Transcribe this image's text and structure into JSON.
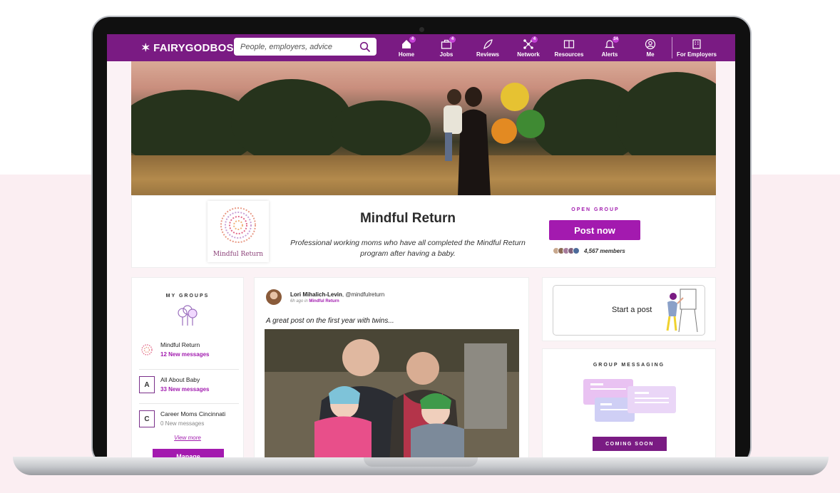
{
  "nav": {
    "logo": "FAIRYGODBOSS",
    "search_placeholder": "People, employers, advice",
    "items": [
      {
        "label": "Home",
        "icon": "home-icon",
        "badge": "4"
      },
      {
        "label": "Jobs",
        "icon": "briefcase-icon",
        "badge": "4"
      },
      {
        "label": "Reviews",
        "icon": "feather-icon",
        "badge": ""
      },
      {
        "label": "Network",
        "icon": "network-icon",
        "badge": "4"
      },
      {
        "label": "Resources",
        "icon": "book-icon",
        "badge": ""
      },
      {
        "label": "Alerts",
        "icon": "bell-icon",
        "badge": "34"
      },
      {
        "label": "Me",
        "icon": "user-circle-icon",
        "badge": ""
      }
    ],
    "employers_label": "For Employers"
  },
  "group": {
    "logo_text": "Mindful Return",
    "title": "Mindful Return",
    "description": "Professional working moms who have all completed the Mindful Return program after having a baby.",
    "status": "OPEN GROUP",
    "post_button": "Post now",
    "members": "4,567 members"
  },
  "my_groups": {
    "title": "MY GROUPS",
    "items": [
      {
        "thumb": "",
        "name": "Mindful Return",
        "messages": "12 New messages"
      },
      {
        "thumb": "A",
        "name": "All About Baby",
        "messages": "33 New messages"
      },
      {
        "thumb": "C",
        "name": "Career Moms Cincinnati",
        "messages": "0 New messages"
      }
    ],
    "view_more": "View more",
    "manage": "Manage"
  },
  "post": {
    "author": "Lori Mihalich-Levin",
    "handle": ", @mindfulreturn",
    "time": "6h ago in ",
    "group": "Mindful Return",
    "text": "A great post on the first year with twins..."
  },
  "start_post": {
    "label": "Start a post"
  },
  "group_messaging": {
    "title": "GROUP MESSAGING",
    "button": "COMING SOON"
  },
  "colors": {
    "brand": "#7a1b83",
    "accent": "#a31aaf"
  }
}
